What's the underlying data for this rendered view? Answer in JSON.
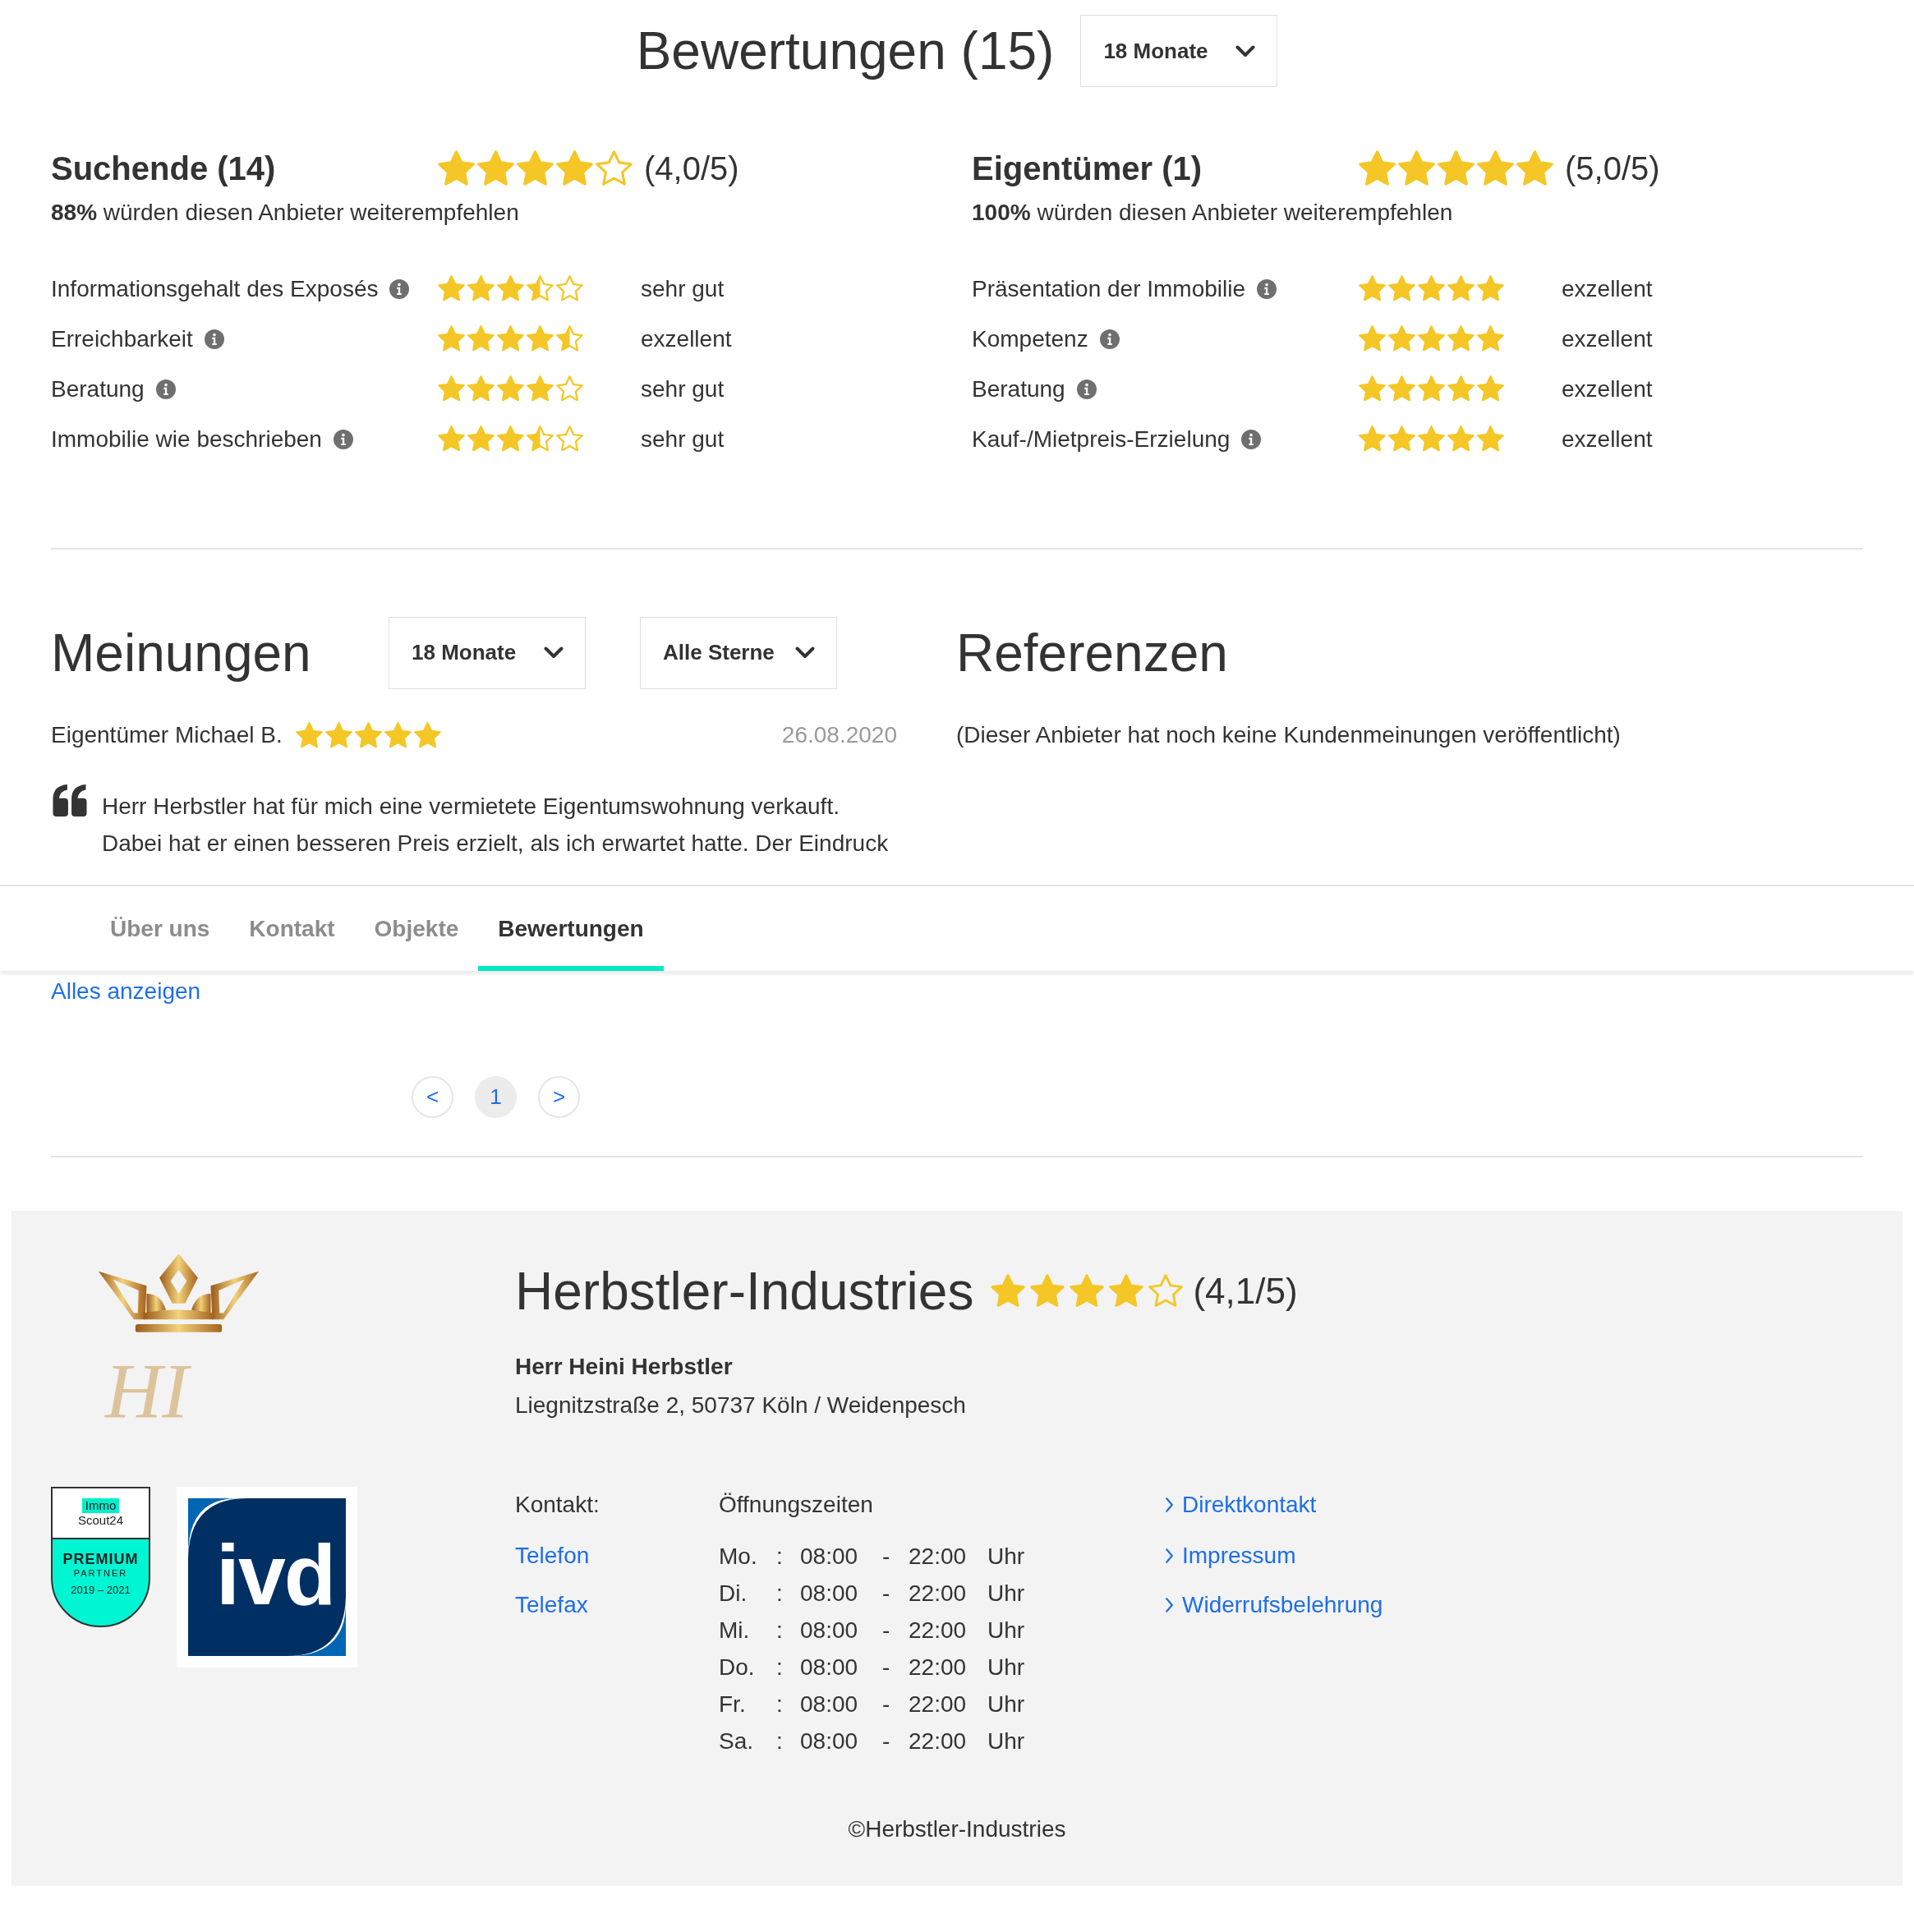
{
  "header": {
    "title": "Bewertungen (15)",
    "period_filter": "18 Monate"
  },
  "rating_groups": [
    {
      "title": "Suchende (14)",
      "stars": 4,
      "score": "(4,0/5)",
      "recommendation": "**88%** würden diesen Anbieter weiterempfehlen",
      "criteria": [
        {
          "label": "Informationsgehalt des Exposés",
          "stars": 3.5,
          "rating": "sehr gut"
        },
        {
          "label": "Erreichbarkeit",
          "stars": 4.5,
          "rating": "exzellent"
        },
        {
          "label": "Beratung",
          "stars": 4,
          "rating": "sehr gut"
        },
        {
          "label": "Immobilie wie beschrieben",
          "stars": 3.5,
          "rating": "sehr gut"
        }
      ]
    },
    {
      "title": "Eigentümer (1)",
      "stars": 5,
      "score": "(5,0/5)",
      "recommendation": "**100%** würden diesen Anbieter weiterempfehlen",
      "criteria": [
        {
          "label": "Präsentation der Immobilie",
          "stars": 5,
          "rating": "exzellent"
        },
        {
          "label": "Kompetenz",
          "stars": 5,
          "rating": "exzellent"
        },
        {
          "label": "Beratung",
          "stars": 5,
          "rating": "exzellent"
        },
        {
          "label": "Kauf-/Mietpreis-Erzielung",
          "stars": 5,
          "rating": "exzellent"
        }
      ]
    }
  ],
  "opinions": {
    "title": "Meinungen",
    "filters": [
      "18 Monate",
      "Alle Sterne"
    ],
    "reviews": [
      {
        "author": "Eigentümer Michael B.",
        "stars": 5,
        "date": "26.08.2020",
        "text": "Herr Herbstler hat für mich eine vermietete Eigentumswohnung verkauft. Dabei hat er einen besseren Preis erzielt, als ich erwartet hatte. Der Eindruck"
      }
    ],
    "show_all_link": "Alles anzeigen",
    "pagination": {
      "prev": "<",
      "pages": [
        {
          "label": "1",
          "selected": true
        }
      ],
      "next": ">"
    }
  },
  "references": {
    "title": "Referenzen",
    "empty_text": "(Dieser Anbieter hat noch keine Kundenmeinungen veröffentlicht)"
  },
  "tab_bar": {
    "tabs": [
      {
        "label": "Über uns",
        "selected": false
      },
      {
        "label": "Kontakt",
        "selected": false
      },
      {
        "label": "Objekte",
        "selected": false
      },
      {
        "label": "Bewertungen",
        "selected": true
      }
    ]
  },
  "footer": {
    "logo": {
      "monogram": "HI"
    },
    "premium_badge": {
      "brand_top": "Immo",
      "brand_bottom": "Scout24",
      "title": "PREMIUM",
      "subtitle": "PARTNER",
      "years": "2019 – 2021"
    },
    "association_logo": {
      "text": "ivd"
    },
    "company": {
      "name": "Herbstler-Industries",
      "stars": 4,
      "score": "(4,1/5)"
    },
    "contact_person": "Herr Heini Herbstler",
    "address": "Liegnitzstraße 2, 50737 Köln / Weidenpesch",
    "contact": {
      "label": "Kontakt:",
      "links": [
        "Telefon",
        "Telefax"
      ]
    },
    "opening_hours": {
      "title": "Öffnungszeiten",
      "rows": [
        {
          "day": "Mo.",
          "separator": ":",
          "open": "08:00",
          "dash": "-",
          "close": "22:00",
          "unit": "Uhr"
        },
        {
          "day": "Di.",
          "separator": ":",
          "open": "08:00",
          "dash": "-",
          "close": "22:00",
          "unit": "Uhr"
        },
        {
          "day": "Mi.",
          "separator": ":",
          "open": "08:00",
          "dash": "-",
          "close": "22:00",
          "unit": "Uhr"
        },
        {
          "day": "Do.",
          "separator": ":",
          "open": "08:00",
          "dash": "-",
          "close": "22:00",
          "unit": "Uhr"
        },
        {
          "day": "Fr.",
          "separator": ":",
          "open": "08:00",
          "dash": "-",
          "close": "22:00",
          "unit": "Uhr"
        },
        {
          "day": "Sa.",
          "separator": ":",
          "open": "08:00",
          "dash": "-",
          "close": "22:00",
          "unit": "Uhr"
        }
      ]
    },
    "links": [
      "Direktkontakt",
      "Impressum",
      "Widerrufsbelehrung"
    ],
    "copyright": "©Herbstler-Industries"
  }
}
